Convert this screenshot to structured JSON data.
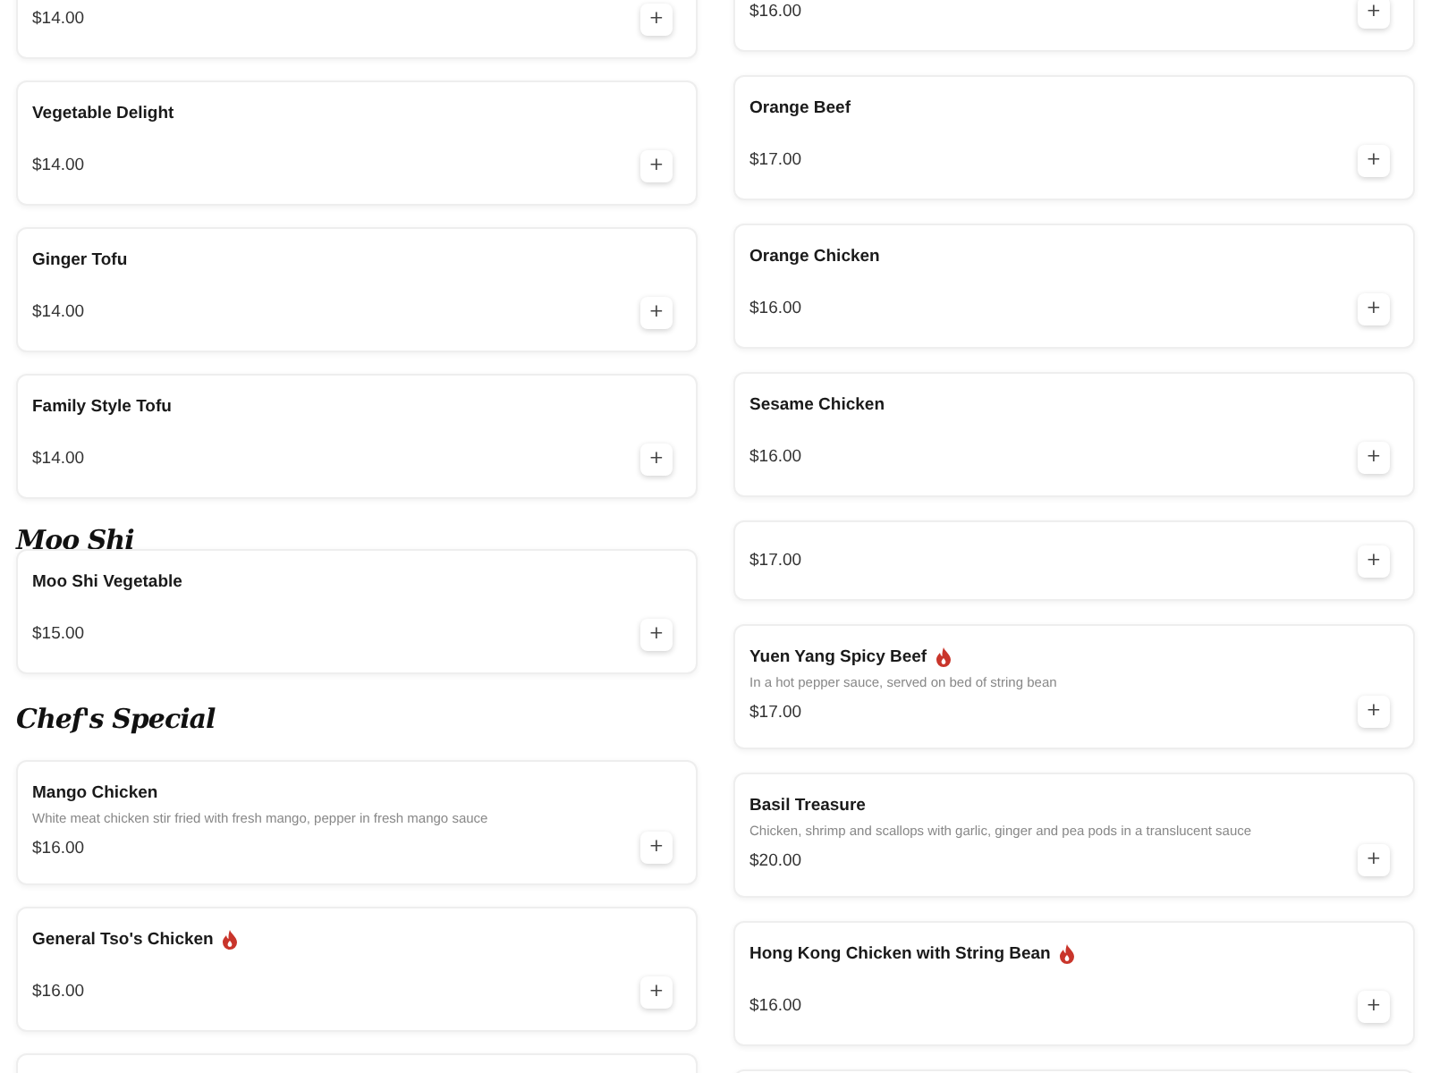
{
  "columns": [
    {
      "entries": [
        {
          "kind": "item",
          "price": "$14.00",
          "button": "+"
        },
        {
          "kind": "item",
          "name": "Vegetable Delight",
          "spicy": false,
          "price": "$14.00",
          "button": "+"
        },
        {
          "kind": "item",
          "name": "Ginger Tofu",
          "spicy": false,
          "price": "$14.00",
          "button": "+"
        },
        {
          "kind": "item",
          "name": "Family Style Tofu",
          "spicy": false,
          "price": "$14.00",
          "button": "+"
        },
        {
          "kind": "heading",
          "title": "Moo Shi"
        },
        {
          "kind": "item",
          "name": "Moo Shi Vegetable",
          "spicy": false,
          "price": "$15.00",
          "button": "+"
        },
        {
          "kind": "heading",
          "title": "Chef's Special"
        },
        {
          "kind": "item",
          "name": "Mango Chicken",
          "spicy": false,
          "description": "White meat chicken stir fried with fresh mango, pepper in fresh mango sauce",
          "price": "$16.00",
          "button": "+"
        },
        {
          "kind": "item",
          "name": "General Tso's Chicken",
          "spicy": true,
          "price": "$16.00",
          "button": "+"
        },
        {
          "kind": "item"
        }
      ]
    },
    {
      "entries": [
        {
          "kind": "item",
          "price": "$16.00",
          "button": "+"
        },
        {
          "kind": "item",
          "name": "Orange Beef",
          "spicy": false,
          "price": "$17.00",
          "button": "+"
        },
        {
          "kind": "item",
          "name": "Orange Chicken",
          "spicy": false,
          "price": "$16.00",
          "button": "+"
        },
        {
          "kind": "item",
          "name": "Sesame Chicken",
          "spicy": false,
          "price": "$16.00",
          "button": "+"
        },
        {
          "kind": "item",
          "price": "$17.00",
          "button": "+"
        },
        {
          "kind": "item",
          "name": "Yuen Yang Spicy Beef",
          "spicy": true,
          "description": "In a hot pepper sauce, served on bed of string bean",
          "price": "$17.00",
          "button": "+"
        },
        {
          "kind": "item",
          "name": "Basil Treasure",
          "spicy": false,
          "description": "Chicken, shrimp and scallops with garlic, ginger and pea pods in a translucent sauce",
          "price": "$20.00",
          "button": "+"
        },
        {
          "kind": "item",
          "name": "Hong Kong Chicken with String Bean",
          "spicy": true,
          "price": "$16.00",
          "button": "+"
        },
        {
          "kind": "item"
        }
      ]
    }
  ]
}
